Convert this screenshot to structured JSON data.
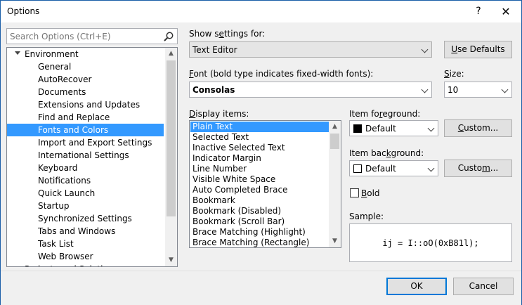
{
  "window": {
    "title": "Options",
    "help_label": "?",
    "close_label": "✕"
  },
  "search": {
    "placeholder": "Search Options (Ctrl+E)"
  },
  "tree": {
    "root_label": "Environment",
    "items": [
      "General",
      "AutoRecover",
      "Documents",
      "Extensions and Updates",
      "Find and Replace",
      "Fonts and Colors",
      "Import and Export Settings",
      "International Settings",
      "Keyboard",
      "Notifications",
      "Quick Launch",
      "Startup",
      "Synchronized Settings",
      "Tabs and Windows",
      "Task List",
      "Web Browser"
    ],
    "next_root_label": "Projects and Solutions",
    "selected_index": 5
  },
  "settings": {
    "show_settings_label": "Show settings for:",
    "show_settings_value": "Text Editor",
    "use_defaults_label": "Use Defaults",
    "font_label": "Font (bold type indicates fixed-width fonts):",
    "font_value": "Consolas",
    "size_label": "Size:",
    "size_value": "10"
  },
  "display_items": {
    "label": "Display items:",
    "items": [
      "Plain Text",
      "Selected Text",
      "Inactive Selected Text",
      "Indicator Margin",
      "Line Number",
      "Visible White Space",
      "Auto Completed Brace",
      "Bookmark",
      "Bookmark (Disabled)",
      "Bookmark (Scroll Bar)",
      "Brace Matching (Highlight)",
      "Brace Matching (Rectangle)"
    ],
    "selected_index": 0
  },
  "foreground": {
    "label": "Item foreground:",
    "value": "Default",
    "swatch_color": "#000000",
    "custom_label": "Custom..."
  },
  "background": {
    "label": "Item background:",
    "value": "Default",
    "swatch_color": "#ffffff",
    "custom_label": "Custom..."
  },
  "bold": {
    "label": "Bold",
    "checked": false
  },
  "sample": {
    "label": "Sample:",
    "text": "ij = I::oO(0xB81l);"
  },
  "buttons": {
    "ok_label": "OK",
    "cancel_label": "Cancel"
  },
  "colors": {
    "selection": "#3399ff",
    "default_button_border": "#0078d7"
  }
}
